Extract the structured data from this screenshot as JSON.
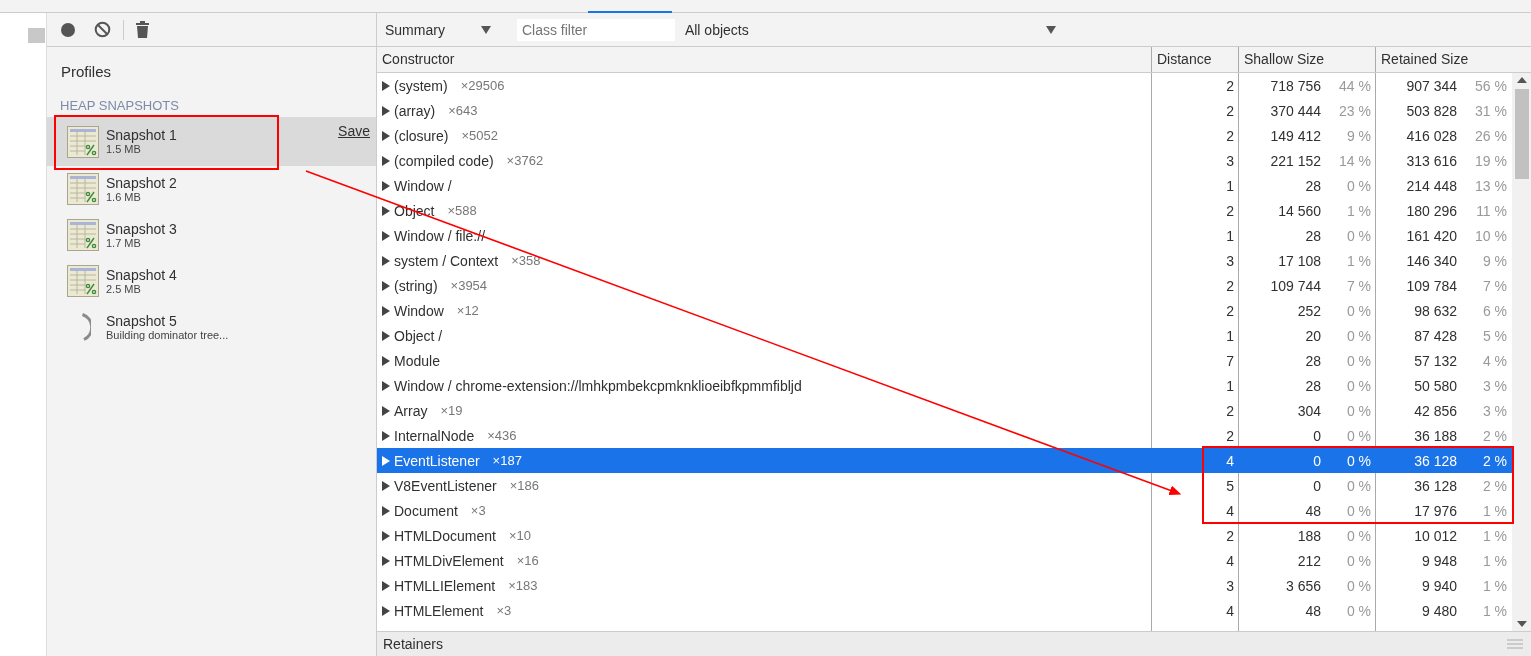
{
  "toolbar": {
    "view": "Summary",
    "class_filter": {
      "placeholder": "Class filter"
    },
    "scope": "All objects"
  },
  "sidebar": {
    "title": "Profiles",
    "section": "HEAP SNAPSHOTS",
    "items": [
      {
        "kind": "snapshot",
        "name": "Snapshot 1",
        "detail": "1.5 MB",
        "selected": true,
        "action": "Save"
      },
      {
        "kind": "snapshot",
        "name": "Snapshot 2",
        "detail": "1.6 MB",
        "selected": false
      },
      {
        "kind": "snapshot",
        "name": "Snapshot 3",
        "detail": "1.7 MB",
        "selected": false
      },
      {
        "kind": "snapshot",
        "name": "Snapshot 4",
        "detail": "2.5 MB",
        "selected": false
      },
      {
        "kind": "loading",
        "name": "Snapshot 5",
        "detail": "Building dominator tree...",
        "selected": false
      }
    ]
  },
  "table": {
    "columns": [
      "Constructor",
      "Distance",
      "Shallow Size",
      "Retained Size"
    ],
    "rows": [
      {
        "constructor": "(system)",
        "count": "×29506",
        "distance": "2",
        "shallow": "718 756",
        "shallow_pct": "44 %",
        "retained": "907 344",
        "retained_pct": "56 %",
        "selected": false
      },
      {
        "constructor": "(array)",
        "count": "×643",
        "distance": "2",
        "shallow": "370 444",
        "shallow_pct": "23 %",
        "retained": "503 828",
        "retained_pct": "31 %",
        "selected": false
      },
      {
        "constructor": "(closure)",
        "count": "×5052",
        "distance": "2",
        "shallow": "149 412",
        "shallow_pct": "9 %",
        "retained": "416 028",
        "retained_pct": "26 %",
        "selected": false
      },
      {
        "constructor": "(compiled code)",
        "count": "×3762",
        "distance": "3",
        "shallow": "221 152",
        "shallow_pct": "14 %",
        "retained": "313 616",
        "retained_pct": "19 %",
        "selected": false
      },
      {
        "constructor": "Window /",
        "distance": "1",
        "shallow": "28",
        "shallow_pct": "0 %",
        "retained": "214 448",
        "retained_pct": "13 %",
        "selected": false
      },
      {
        "constructor": "Object",
        "count": "×588",
        "distance": "2",
        "shallow": "14 560",
        "shallow_pct": "1 %",
        "retained": "180 296",
        "retained_pct": "11 %",
        "selected": false
      },
      {
        "constructor": "Window / file://",
        "distance": "1",
        "shallow": "28",
        "shallow_pct": "0 %",
        "retained": "161 420",
        "retained_pct": "10 %",
        "selected": false
      },
      {
        "constructor": "system / Context",
        "count": "×358",
        "distance": "3",
        "shallow": "17 108",
        "shallow_pct": "1 %",
        "retained": "146 340",
        "retained_pct": "9 %",
        "selected": false
      },
      {
        "constructor": "(string)",
        "count": "×3954",
        "distance": "2",
        "shallow": "109 744",
        "shallow_pct": "7 %",
        "retained": "109 784",
        "retained_pct": "7 %",
        "selected": false
      },
      {
        "constructor": "Window",
        "count": "×12",
        "distance": "2",
        "shallow": "252",
        "shallow_pct": "0 %",
        "retained": "98 632",
        "retained_pct": "6 %",
        "selected": false
      },
      {
        "constructor": "Object /",
        "distance": "1",
        "shallow": "20",
        "shallow_pct": "0 %",
        "retained": "87 428",
        "retained_pct": "5 %",
        "selected": false
      },
      {
        "constructor": "Module",
        "distance": "7",
        "shallow": "28",
        "shallow_pct": "0 %",
        "retained": "57 132",
        "retained_pct": "4 %",
        "selected": false
      },
      {
        "constructor": "Window / chrome-extension://lmhkpmbekcpmknklioeibfkpmmfibljd",
        "distance": "1",
        "shallow": "28",
        "shallow_pct": "0 %",
        "retained": "50 580",
        "retained_pct": "3 %",
        "selected": false
      },
      {
        "constructor": "Array",
        "count": "×19",
        "distance": "2",
        "shallow": "304",
        "shallow_pct": "0 %",
        "retained": "42 856",
        "retained_pct": "3 %",
        "selected": false
      },
      {
        "constructor": "InternalNode",
        "count": "×436",
        "distance": "2",
        "shallow": "0",
        "shallow_pct": "0 %",
        "retained": "36 188",
        "retained_pct": "2 %",
        "selected": false
      },
      {
        "constructor": "EventListener",
        "count": "×187",
        "distance": "4",
        "shallow": "0",
        "shallow_pct": "0 %",
        "retained": "36 128",
        "retained_pct": "2 %",
        "selected": true
      },
      {
        "constructor": "V8EventListener",
        "count": "×186",
        "distance": "5",
        "shallow": "0",
        "shallow_pct": "0 %",
        "retained": "36 128",
        "retained_pct": "2 %",
        "selected": false
      },
      {
        "constructor": "Document",
        "count": "×3",
        "distance": "4",
        "shallow": "48",
        "shallow_pct": "0 %",
        "retained": "17 976",
        "retained_pct": "1 %",
        "selected": false
      },
      {
        "constructor": "HTMLDocument",
        "count": "×10",
        "distance": "2",
        "shallow": "188",
        "shallow_pct": "0 %",
        "retained": "10 012",
        "retained_pct": "1 %",
        "selected": false
      },
      {
        "constructor": "HTMLDivElement",
        "count": "×16",
        "distance": "4",
        "shallow": "212",
        "shallow_pct": "0 %",
        "retained": "9 948",
        "retained_pct": "1 %",
        "selected": false
      },
      {
        "constructor": "HTMLLIElement",
        "count": "×183",
        "distance": "3",
        "shallow": "3 656",
        "shallow_pct": "0 %",
        "retained": "9 940",
        "retained_pct": "1 %",
        "selected": false
      },
      {
        "constructor": "HTMLElement",
        "count": "×3",
        "distance": "4",
        "shallow": "48",
        "shallow_pct": "0 %",
        "retained": "9 480",
        "retained_pct": "1 %",
        "selected": false
      }
    ]
  },
  "retainers": {
    "title": "Retainers"
  }
}
